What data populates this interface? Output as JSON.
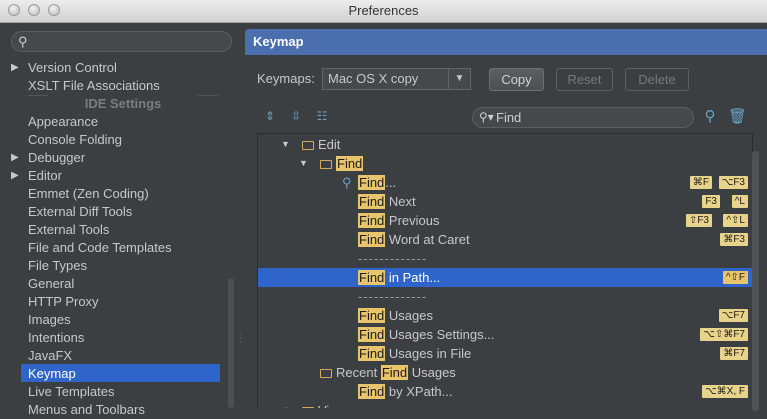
{
  "window": {
    "title": "Preferences"
  },
  "sidebar": {
    "search_placeholder": "",
    "section_header": "IDE Settings",
    "items": [
      {
        "label": "Version Control",
        "expandable": true
      },
      {
        "label": "XSLT File Associations",
        "expandable": false
      },
      {
        "label": "Appearance",
        "expandable": false
      },
      {
        "label": "Console Folding",
        "expandable": false
      },
      {
        "label": "Debugger",
        "expandable": true
      },
      {
        "label": "Editor",
        "expandable": true
      },
      {
        "label": "Emmet (Zen Coding)",
        "expandable": false
      },
      {
        "label": "External Diff Tools",
        "expandable": false
      },
      {
        "label": "External Tools",
        "expandable": false
      },
      {
        "label": "File and Code Templates",
        "expandable": false
      },
      {
        "label": "File Types",
        "expandable": false
      },
      {
        "label": "General",
        "expandable": false
      },
      {
        "label": "HTTP Proxy",
        "expandable": false
      },
      {
        "label": "Images",
        "expandable": false
      },
      {
        "label": "Intentions",
        "expandable": false
      },
      {
        "label": "JavaFX",
        "expandable": false
      },
      {
        "label": "Keymap",
        "expandable": false,
        "selected": true
      },
      {
        "label": "Live Templates",
        "expandable": false
      },
      {
        "label": "Menus and Toolbars",
        "expandable": false
      }
    ]
  },
  "main": {
    "title": "Keymap",
    "keymaps_label": "Keymaps:",
    "keymap_selected": "Mac OS X copy",
    "buttons": {
      "copy": "Copy",
      "reset": "Reset",
      "delete": "Delete"
    },
    "find_query": "Find",
    "tree": [
      {
        "pre": "",
        "match": "",
        "post": "Edit",
        "level": 0,
        "folder": true,
        "arrow": "▼"
      },
      {
        "pre": "",
        "match": "Find",
        "post": "",
        "level": 1,
        "folder": true,
        "arrow": "▼"
      },
      {
        "pre": "",
        "match": "Find",
        "post": "...",
        "level": 2,
        "icon": "search",
        "shortcuts": [
          "⌘F",
          "⌥F3"
        ]
      },
      {
        "pre": "",
        "match": "Find",
        "post": " Next",
        "level": 2,
        "shortcuts": [
          "F3",
          "^L"
        ]
      },
      {
        "pre": "",
        "match": "Find",
        "post": " Previous",
        "level": 2,
        "shortcuts": [
          "⇧F3",
          "^⇧L"
        ]
      },
      {
        "pre": "",
        "match": "Find",
        "post": " Word at Caret",
        "level": 2,
        "shortcuts": [
          "⌘F3"
        ]
      },
      {
        "separator": "-------------",
        "level": 2
      },
      {
        "pre": "",
        "match": "Find",
        "post": " in Path...",
        "level": 2,
        "selected": true,
        "shortcuts": [
          "^⇧F"
        ]
      },
      {
        "separator": "-------------",
        "level": 2
      },
      {
        "pre": "",
        "match": "Find",
        "post": " Usages",
        "level": 2,
        "shortcuts": [
          "⌥F7"
        ]
      },
      {
        "pre": "",
        "match": "Find",
        "post": " Usages Settings...",
        "level": 2,
        "shortcuts": [
          "⌥⇧⌘F7"
        ]
      },
      {
        "pre": "",
        "match": "Find",
        "post": " Usages in File",
        "level": 2,
        "shortcuts": [
          "⌘F7"
        ]
      },
      {
        "pre": "Recent ",
        "match": "Find",
        "post": " Usages",
        "level": 1,
        "folder": true
      },
      {
        "pre": "",
        "match": "Find",
        "post": " by XPath...",
        "level": 2,
        "shortcuts": [
          "⌥⌘X, F"
        ]
      },
      {
        "pre": "",
        "match": "",
        "post": "View",
        "level": 0,
        "folder": true,
        "arrow": "▼"
      }
    ]
  }
}
